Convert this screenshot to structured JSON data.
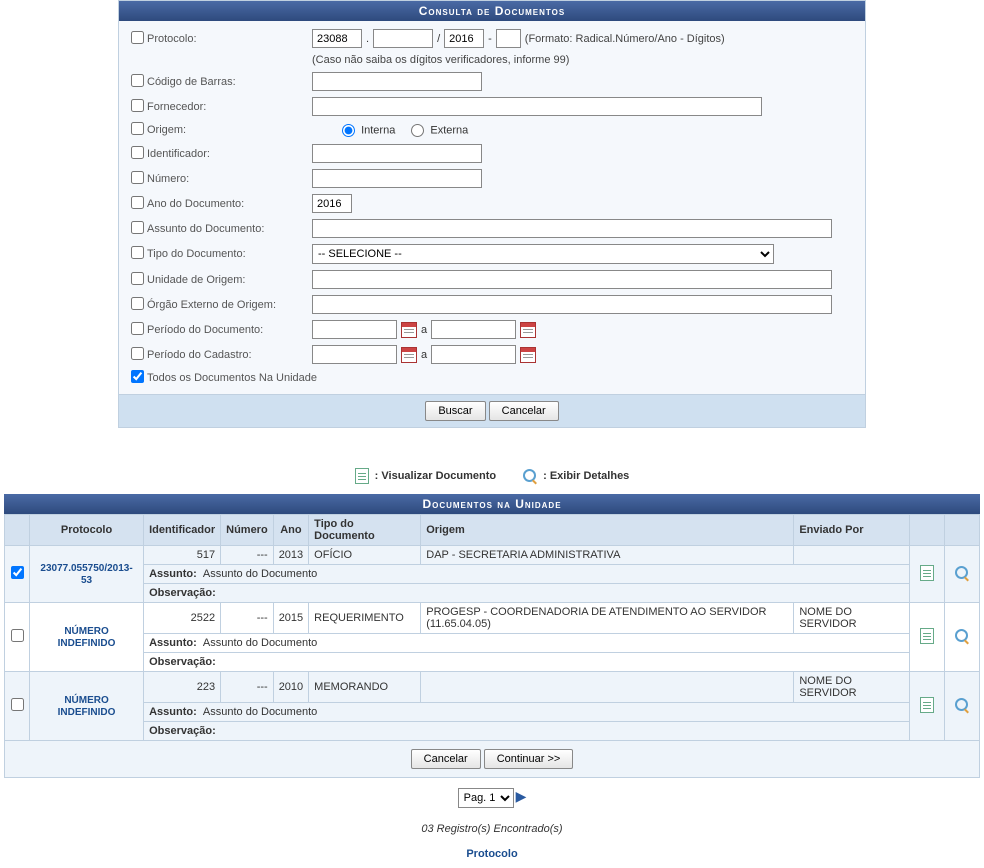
{
  "panel": {
    "title": "Consulta de Documentos",
    "labels": {
      "protocolo": "Protocolo:",
      "codigo_barras": "Código de Barras:",
      "fornecedor": "Fornecedor:",
      "origem": "Origem:",
      "identificador": "Identificador:",
      "numero": "Número:",
      "ano_documento": "Ano do Documento:",
      "assunto": "Assunto do Documento:",
      "tipo_documento": "Tipo do Documento:",
      "unidade_origem": "Unidade de Origem:",
      "orgao_externo": "Órgão Externo de Origem:",
      "periodo_documento": "Período do Documento:",
      "periodo_cadastro": "Período do Cadastro:",
      "todos": "Todos os Documentos Na Unidade"
    },
    "values": {
      "protocolo_radical": "23088",
      "protocolo_numero": "",
      "protocolo_ano": "2016",
      "protocolo_digitos": "",
      "codigo_barras": "",
      "fornecedor": "",
      "identificador": "",
      "numero": "",
      "ano_documento": "2016",
      "assunto": "",
      "unidade_origem": "",
      "orgao_externo": "",
      "periodo_doc_ini": "",
      "periodo_doc_fim": "",
      "periodo_cad_ini": "",
      "periodo_cad_fim": ""
    },
    "hints": {
      "formato": "(Formato: Radical.Número/Ano - Dígitos)",
      "digitos": "(Caso não saiba os dígitos verificadores, informe 99)",
      "sep_dot": ".",
      "sep_slash": "/",
      "sep_dash": "-",
      "sep_a": "a"
    },
    "radio": {
      "interna": "Interna",
      "externa": "Externa",
      "selected": "interna"
    },
    "tipo_select": "-- SELECIONE --",
    "buttons": {
      "buscar": "Buscar",
      "cancelar": "Cancelar"
    }
  },
  "legend": {
    "visualizar": ": Visualizar Documento",
    "exibir": ": Exibir Detalhes"
  },
  "results": {
    "title": "Documentos na Unidade",
    "headers": {
      "protocolo": "Protocolo",
      "identificador": "Identificador",
      "numero": "Número",
      "ano": "Ano",
      "tipo": "Tipo do Documento",
      "origem": "Origem",
      "enviado_por": "Enviado Por"
    },
    "sublabels": {
      "assunto": "Assunto:",
      "observacao": "Observação:"
    },
    "rows": [
      {
        "checked": true,
        "protocolo": "23077.055750/2013-53",
        "identificador": "517",
        "numero": "---",
        "ano": "2013",
        "tipo": "OFÍCIO",
        "origem": "DAP - SECRETARIA ADMINISTRATIVA",
        "enviado_por": "",
        "assunto": "Assunto do Documento",
        "observacao": ""
      },
      {
        "checked": false,
        "protocolo": "NÚMERO INDEFINIDO",
        "identificador": "2522",
        "numero": "---",
        "ano": "2015",
        "tipo": "REQUERIMENTO",
        "origem": "PROGESP - COORDENADORIA DE ATENDIMENTO AO SERVIDOR (11.65.04.05)",
        "enviado_por": "NOME DO SERVIDOR",
        "assunto": "Assunto do Documento",
        "observacao": ""
      },
      {
        "checked": false,
        "protocolo": "NÚMERO INDEFINIDO",
        "identificador": "223",
        "numero": "---",
        "ano": "2010",
        "tipo": "MEMORANDO",
        "origem": "",
        "enviado_por": "NOME DO SERVIDOR",
        "assunto": "Assunto do Documento",
        "observacao": ""
      }
    ],
    "buttons": {
      "cancelar": "Cancelar",
      "continuar": "Continuar >>"
    }
  },
  "pager": {
    "label": "Pag. 1"
  },
  "records": "03 Registro(s) Encontrado(s)",
  "footer_link": "Protocolo"
}
